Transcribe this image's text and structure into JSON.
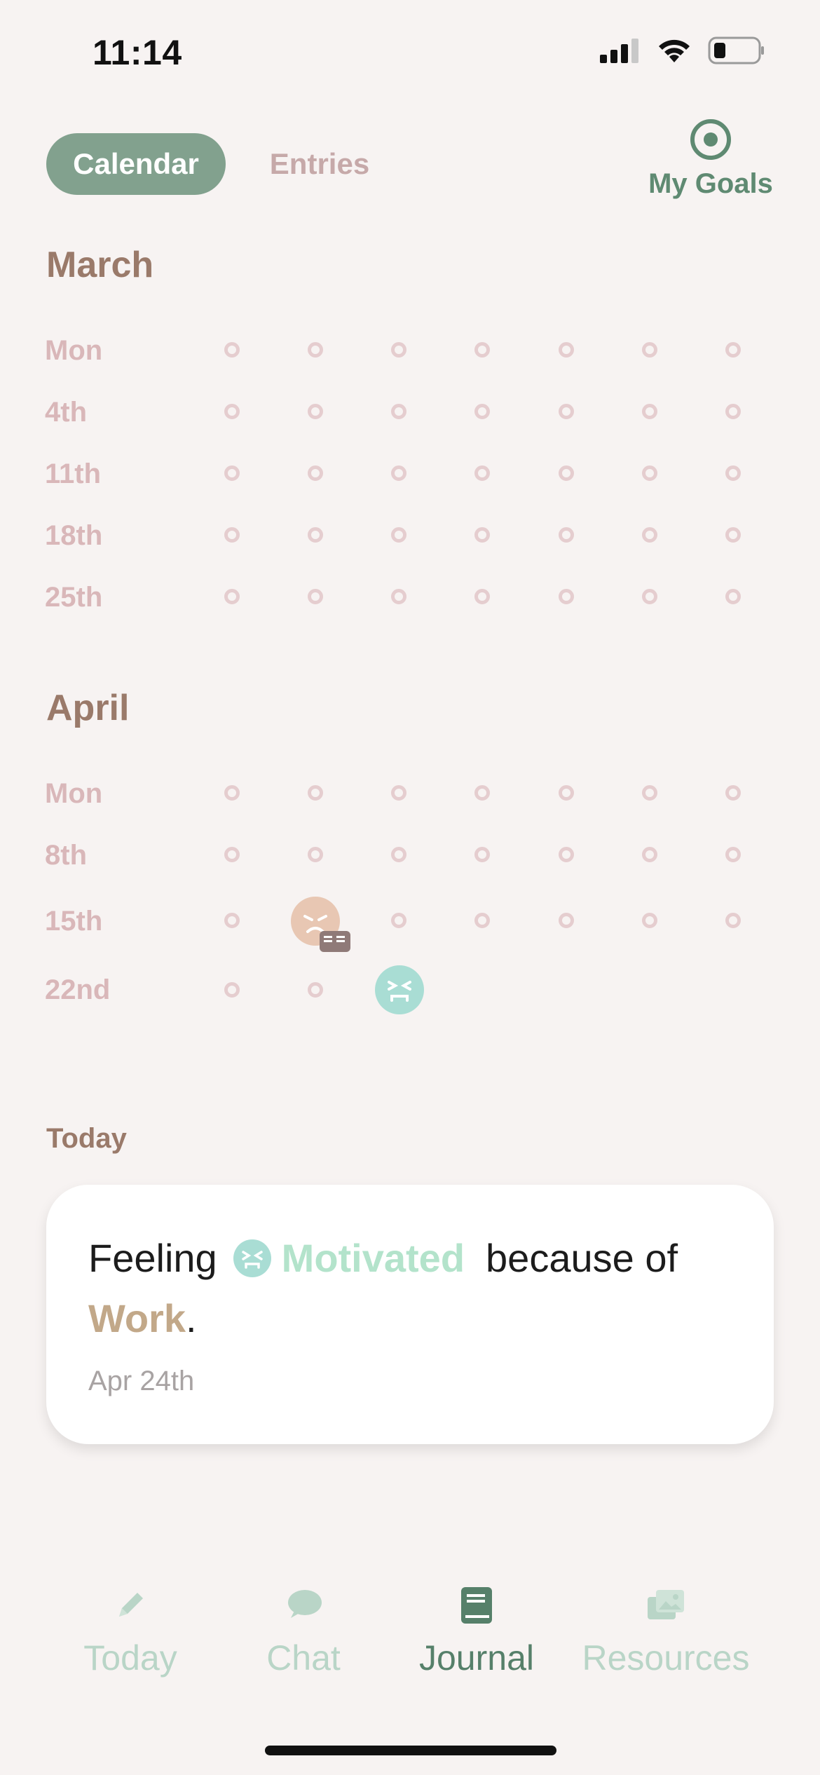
{
  "status_bar": {
    "time": "11:14"
  },
  "header": {
    "tab_calendar": "Calendar",
    "tab_entries": "Entries",
    "goals_label": "My Goals"
  },
  "march": {
    "title": "March",
    "rows": [
      "Mon",
      "4th",
      "11th",
      "18th",
      "25th"
    ]
  },
  "april": {
    "title": "April",
    "rows": [
      "Mon",
      "8th",
      "15th",
      "22nd"
    ]
  },
  "today": {
    "section_title": "Today",
    "prefix": "Feeling",
    "mood": "Motivated",
    "middle": "because of",
    "reason": "Work",
    "suffix": ".",
    "date": "Apr 24th"
  },
  "nav": {
    "items": [
      {
        "label": "Today",
        "icon": "pencil-icon"
      },
      {
        "label": "Chat",
        "icon": "chat-bubble-icon"
      },
      {
        "label": "Journal",
        "icon": "book-icon",
        "active": true
      },
      {
        "label": "Resources",
        "icon": "images-icon"
      }
    ]
  },
  "colors": {
    "accent": "#82a18e",
    "active_nav": "#56806a",
    "inactive_nav": "#b9d5c7",
    "mood_motivated": "#b3e3cb",
    "reason": "#c2a889"
  }
}
